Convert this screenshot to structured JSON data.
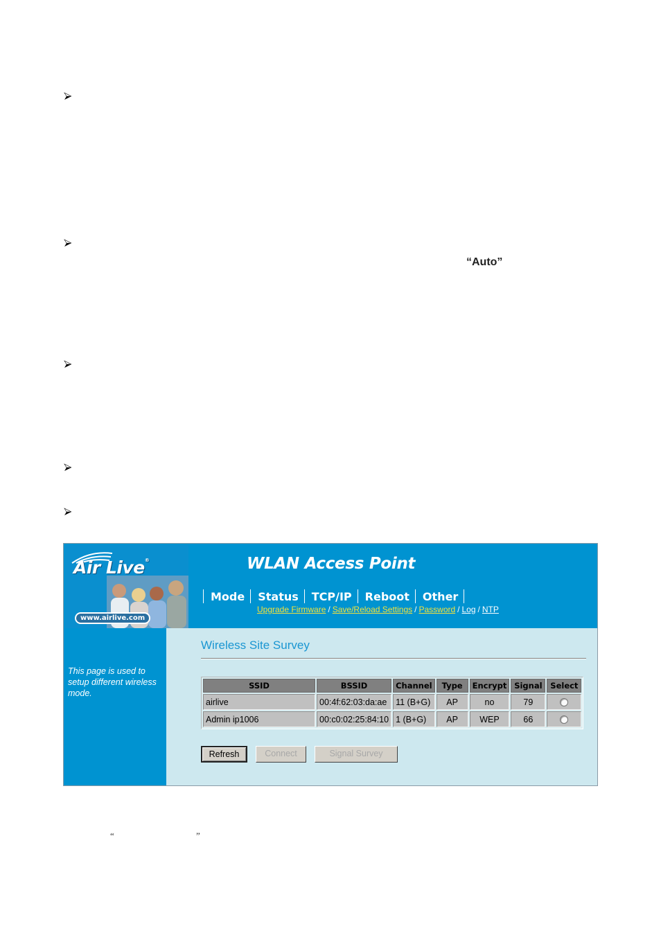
{
  "document": {
    "bullets": [
      "arrow-bullet",
      "arrow-bullet",
      "arrow-bullet",
      "arrow-bullet",
      "arrow-bullet"
    ],
    "emphasis_text": "“Auto”",
    "open_quote": "“",
    "close_quote": "”"
  },
  "app": {
    "brand": "Air Live",
    "brand_mark": "®",
    "brand_url": "www.airlive.com",
    "title": "WLAN Access Point",
    "colors": {
      "header_blue": "#0093d1",
      "content_bg": "#cde8ef",
      "title_blue": "#1a96d2",
      "link_yellow": "#f4e23a"
    }
  },
  "nav": {
    "tabs": [
      {
        "label": "Mode"
      },
      {
        "label": "Status"
      },
      {
        "label": "TCP/IP"
      },
      {
        "label": "Reboot"
      },
      {
        "label": "Other"
      }
    ],
    "sublinks": [
      {
        "label": "Upgrade Firmware",
        "style": "yellow"
      },
      {
        "label": "Save/Reload Settings",
        "style": "yellow"
      },
      {
        "label": "Password",
        "style": "yellow"
      },
      {
        "label": "Log",
        "style": "white"
      },
      {
        "label": "NTP",
        "style": "white"
      }
    ],
    "separator": "/"
  },
  "sidebar": {
    "description": "This page is used to setup different wireless mode."
  },
  "main": {
    "page_title": "Wireless Site Survey",
    "table": {
      "columns": [
        "SSID",
        "BSSID",
        "Channel",
        "Type",
        "Encrypt",
        "Signal",
        "Select"
      ],
      "rows": [
        {
          "ssid": "airlive",
          "bssid": "00:4f:62:03:da:ae",
          "channel": "11 (B+G)",
          "type": "AP",
          "encrypt": "no",
          "signal": "79",
          "selected": false
        },
        {
          "ssid": "Admin ip1006",
          "bssid": "00:c0:02:25:84:10",
          "channel": "1 (B+G)",
          "type": "AP",
          "encrypt": "WEP",
          "signal": "66",
          "selected": false
        }
      ]
    },
    "buttons": {
      "refresh": "Refresh",
      "connect": "Connect",
      "signal_survey": "Signal Survey"
    }
  }
}
